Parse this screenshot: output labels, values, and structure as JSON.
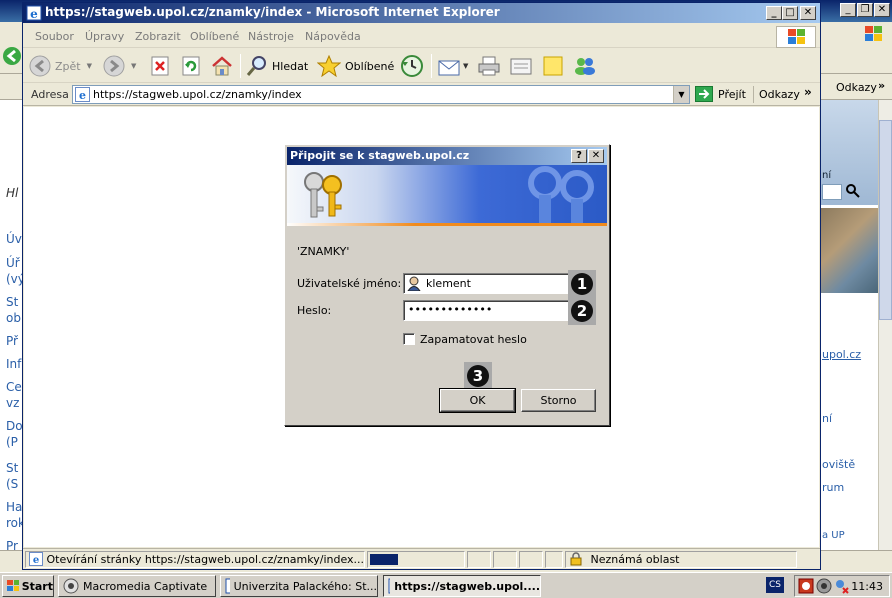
{
  "bg_window": {
    "left_labels": [
      "Hl",
      "Úv",
      "Úř",
      "(vý",
      "St",
      "ob",
      "Př",
      "Inf",
      "Ce",
      "vz",
      "Do",
      "(P",
      "St",
      "(S",
      "Ha",
      "rok",
      "Pr"
    ],
    "right_links": [
      "ní",
      "upol.cz",
      "ní",
      "oviště",
      "rum",
      "a UP"
    ],
    "toolbar_links": "Odkazy",
    "colors": {
      "link": "#2a5fa8"
    }
  },
  "ie": {
    "title": "https://stagweb.upol.cz/znamky/index - Microsoft Internet Explorer",
    "menu": [
      "Soubor",
      "Úpravy",
      "Zobrazit",
      "Oblíbené",
      "Nástroje",
      "Nápověda"
    ],
    "toolbar": {
      "back": "Zpět",
      "search": "Hledat",
      "favorites": "Oblíbené"
    },
    "address": {
      "label": "Adresa",
      "url": "https://stagweb.upol.cz/znamky/index",
      "go": "Přejít",
      "links": "Odkazy"
    },
    "status": {
      "text": "Otevírání stránky https://stagweb.upol.cz/znamky/index...",
      "zone": "Neznámá oblast",
      "progress": 0.3
    }
  },
  "dialog": {
    "title": "Připojit se k stagweb.upol.cz",
    "realm": "'ZNAMKY'",
    "username_label": "Uživatelské jméno:",
    "username_value": "klement",
    "password_label": "Heslo:",
    "password_value": "•••••••••••••",
    "remember_label": "Zapamatovat heslo",
    "remember_checked": false,
    "ok": "OK",
    "cancel": "Storno",
    "markers": [
      "1",
      "2",
      "3"
    ]
  },
  "taskbar": {
    "start": "Start",
    "tasks": [
      "Macromedia Captivate",
      "Univerzita Palackého: St...",
      "https://stagweb.upol...."
    ],
    "lang": "CS",
    "clock": "11:43"
  }
}
